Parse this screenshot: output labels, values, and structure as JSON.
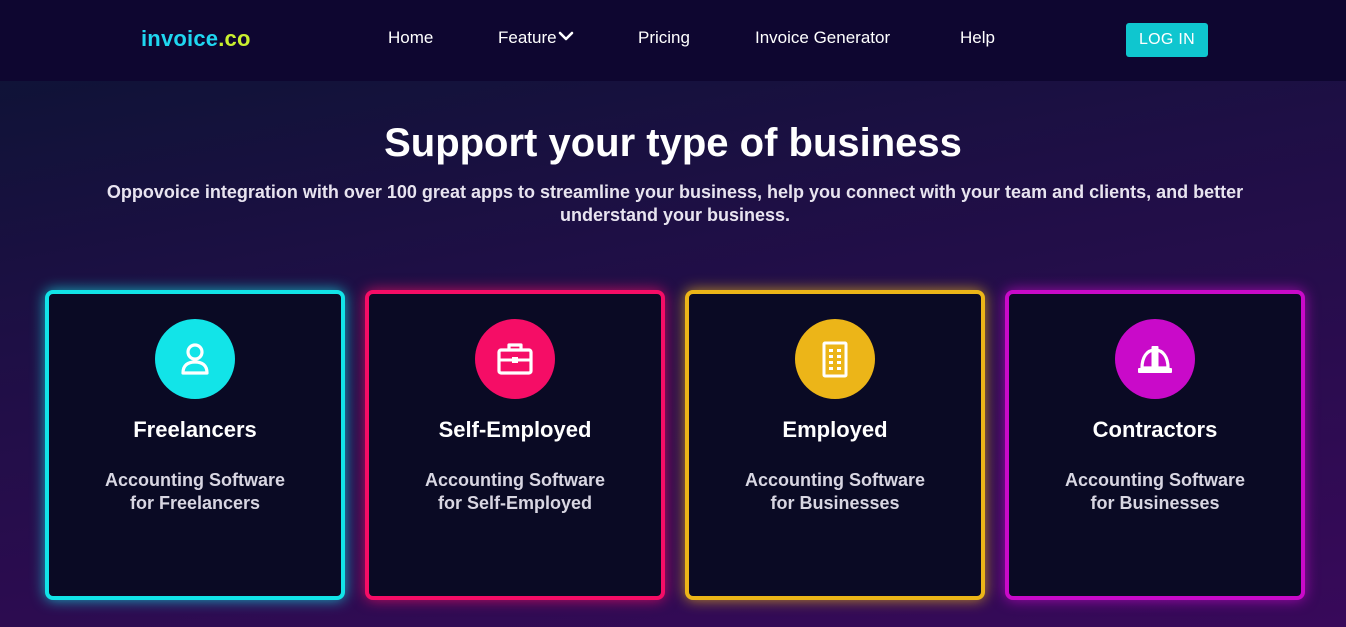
{
  "brand": {
    "part1": "invoice",
    "part2": ".co"
  },
  "nav": {
    "items": [
      {
        "label": "Home"
      },
      {
        "label": "Feature"
      },
      {
        "label": "Pricing"
      },
      {
        "label": "Invoice Generator"
      },
      {
        "label": "Help"
      }
    ],
    "login_label": "LOG IN"
  },
  "hero": {
    "title": "Support your type of business",
    "subtitle": "Oppovoice integration with over 100 great apps to streamline your business, help you connect with your team and clients, and better understand your business."
  },
  "cards": [
    {
      "title": "Freelancers",
      "line1": "Accounting Software",
      "line2": "for Freelancers",
      "color": "#12e4e8",
      "icon": "user-icon"
    },
    {
      "title": "Self-Employed",
      "line1": "Accounting Software",
      "line2": "for Self-Employed",
      "color": "#f50d66",
      "icon": "briefcase-icon"
    },
    {
      "title": "Employed",
      "line1": "Accounting Software",
      "line2": "for Businesses",
      "color": "#ecb518",
      "icon": "building-icon"
    },
    {
      "title": "Contractors",
      "line1": "Accounting Software",
      "line2": "for Businesses",
      "color": "#c90ac9",
      "icon": "hard-hat-icon"
    }
  ],
  "colors": {
    "accent": "#0fc6cf",
    "nav_bg": "#0e0630",
    "logo_primary": "#1fd6f0",
    "logo_secondary": "#c9ef2f"
  }
}
